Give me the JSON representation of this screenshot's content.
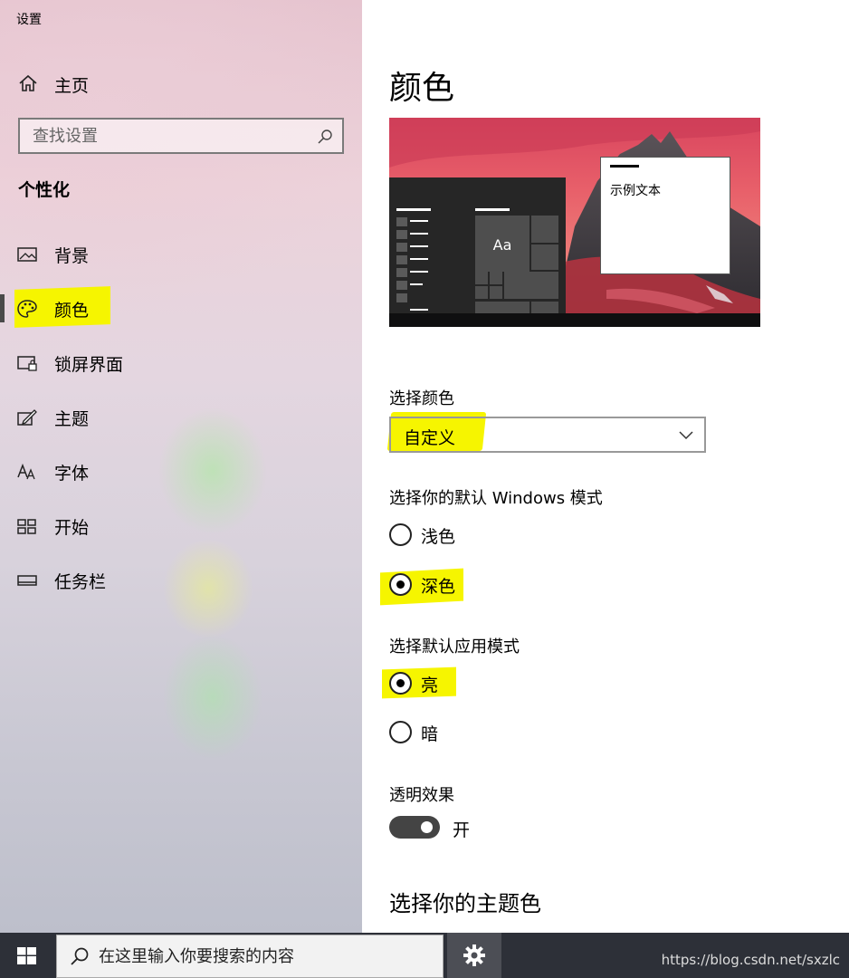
{
  "window": {
    "title": "设置"
  },
  "sidebar": {
    "home_label": "主页",
    "search_placeholder": "查找设置",
    "section_title": "个性化",
    "items": [
      {
        "label": "背景",
        "icon": "picture-icon"
      },
      {
        "label": "颜色",
        "icon": "palette-icon",
        "active": true
      },
      {
        "label": "锁屏界面",
        "icon": "lockscreen-icon"
      },
      {
        "label": "主题",
        "icon": "theme-edit-icon"
      },
      {
        "label": "字体",
        "icon": "font-icon"
      },
      {
        "label": "开始",
        "icon": "start-grid-icon"
      },
      {
        "label": "任务栏",
        "icon": "taskbar-icon"
      }
    ]
  },
  "main": {
    "title": "颜色",
    "preview": {
      "sample_text": "示例文本",
      "tile_label": "Aa"
    },
    "choose_color": {
      "label": "选择颜色",
      "value": "自定义"
    },
    "windows_mode": {
      "label": "选择你的默认 Windows 模式",
      "options": [
        {
          "label": "浅色",
          "selected": false
        },
        {
          "label": "深色",
          "selected": true
        }
      ]
    },
    "app_mode": {
      "label": "选择默认应用模式",
      "options": [
        {
          "label": "亮",
          "selected": true
        },
        {
          "label": "暗",
          "selected": false
        }
      ]
    },
    "transparency": {
      "label": "透明效果",
      "state_label": "开",
      "on": true
    },
    "accent_title": "选择你的主题色"
  },
  "taskbar": {
    "search_placeholder": "在这里输入你要搜索的内容",
    "watermark": "https://blog.csdn.net/sxzlc"
  },
  "colors": {
    "highlight": "#f6f500",
    "taskbar_bg": "#2d3038",
    "toggle_on": "#444444"
  }
}
